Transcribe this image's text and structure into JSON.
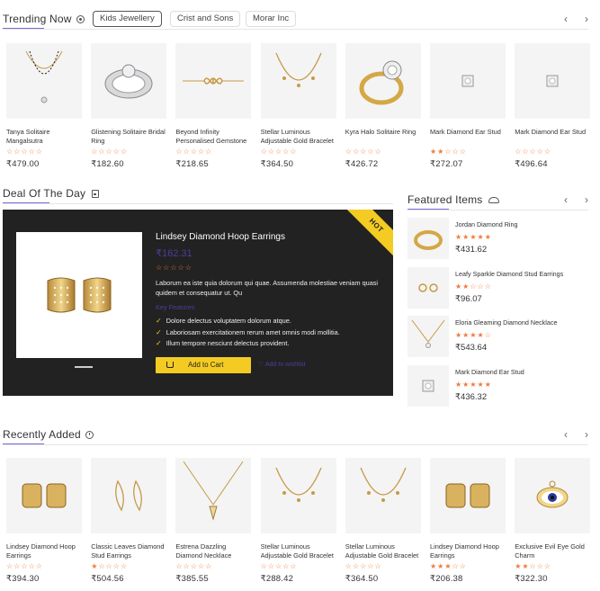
{
  "trending": {
    "title": "Trending Now",
    "tabs": [
      "Kids Jewellery",
      "Crist and Sons",
      "Morar Inc"
    ],
    "products": [
      {
        "name": "Tanya Solitaire Mangalsutra",
        "price": "₹479.00",
        "rating": 0,
        "icon": "mangalsutra-icon"
      },
      {
        "name": "Glistening Solitaire Bridal Ring",
        "price": "₹182.60",
        "rating": 0,
        "icon": "bridal-ring-icon"
      },
      {
        "name": "Beyond Infinity Personalised Gemstone",
        "price": "₹218.65",
        "rating": 0,
        "icon": "infinity-bracelet-icon"
      },
      {
        "name": "Stellar Luminous Adjustable Gold Bracelet",
        "price": "₹364.50",
        "rating": 0,
        "icon": "gold-bracelet-icon"
      },
      {
        "name": "Kyra Halo Solitaire Ring",
        "price": "₹426.72",
        "rating": 0,
        "icon": "halo-ring-icon"
      },
      {
        "name": "Mark Diamond Ear Stud",
        "price": "₹272.07",
        "rating": 2,
        "icon": "ear-stud-icon"
      },
      {
        "name": "Mark Diamond Ear Stud",
        "price": "₹496.64",
        "rating": 0,
        "icon": "ear-stud-icon"
      }
    ]
  },
  "deal": {
    "title": "Deal Of The Day",
    "badge": "HOT",
    "name": "Lindsey Diamond Hoop Earrings",
    "price": "₹162.31",
    "rating": 0,
    "description": "Laborum ea iste quia dolorum qui quae. Assumenda molestiae veniam quasi quidem et consequatur ut. Qu",
    "features_title": "Key Features",
    "features": [
      "Dolore delectus voluptatem dolorum atque.",
      "Laboriosam exercitationem rerum amet omnis modi mollitia.",
      "Illum tempore nesciunt delectus provident."
    ],
    "add_to_cart": "Add to Cart",
    "wishlist": "Add to wishlist"
  },
  "featured": {
    "title": "Featured Items",
    "items": [
      {
        "name": "Jordan Diamond Ring",
        "price": "₹431.62",
        "rating": 5,
        "icon": "diamond-ring-icon"
      },
      {
        "name": "Leafy Sparkle Diamond Stud Earrings",
        "price": "₹96.07",
        "rating": 2,
        "icon": "stud-earrings-icon"
      },
      {
        "name": "Eloria Gleaming Diamond Necklace",
        "price": "₹543.64",
        "rating": 4,
        "icon": "necklace-icon"
      },
      {
        "name": "Mark Diamond Ear Stud",
        "price": "₹436.32",
        "rating": 5,
        "icon": "ear-stud-icon"
      }
    ]
  },
  "recent": {
    "title": "Recently Added",
    "products": [
      {
        "name": "Lindsey Diamond Hoop Earrings",
        "price": "₹394.30",
        "rating": 0,
        "icon": "hoop-earrings-icon"
      },
      {
        "name": "Classic Leaves Diamond Stud Earrings",
        "price": "₹504.56",
        "rating": 1,
        "icon": "leaf-earrings-icon"
      },
      {
        "name": "Estrena Dazzling Diamond Necklace",
        "price": "₹385.55",
        "rating": 0,
        "icon": "pendant-necklace-icon"
      },
      {
        "name": "Stellar Luminous Adjustable Gold Bracelet",
        "price": "₹288.42",
        "rating": 0,
        "icon": "gold-bracelet-icon"
      },
      {
        "name": "Stellar Luminous Adjustable Gold Bracelet",
        "price": "₹364.50",
        "rating": 0,
        "icon": "gold-bracelet-icon"
      },
      {
        "name": "Lindsey Diamond Hoop Earrings",
        "price": "₹206.38",
        "rating": 3,
        "icon": "hoop-earrings-icon"
      },
      {
        "name": "Exclusive Evil Eye Gold Charm",
        "price": "₹322.30",
        "rating": 2,
        "icon": "evil-eye-charm-icon"
      }
    ]
  },
  "colors": {
    "accent": "#7a6bd6",
    "star": "#ef7a3c",
    "deal_bg": "#222222",
    "button": "#f4cb23"
  }
}
